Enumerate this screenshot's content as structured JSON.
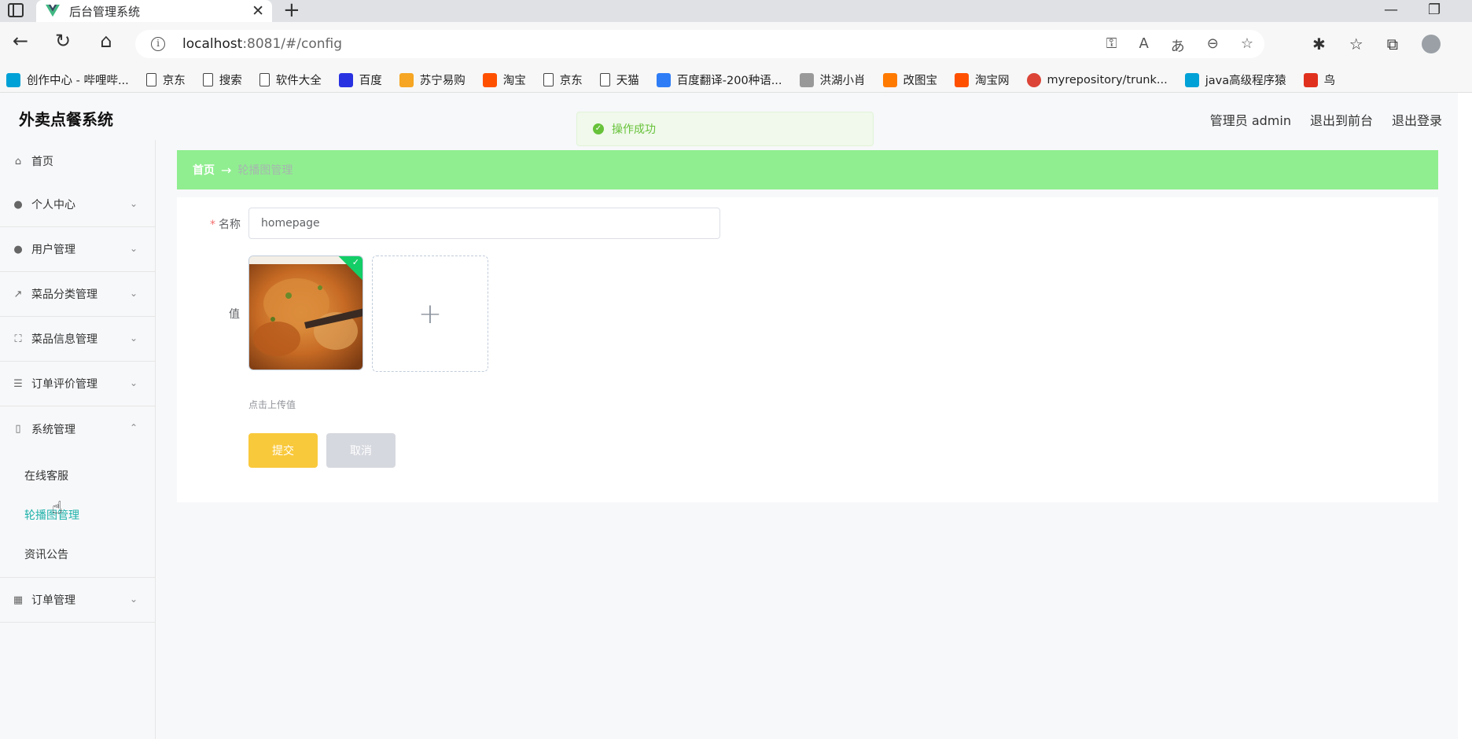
{
  "browser": {
    "tab_title": "后台管理系统",
    "tab_close": "✕",
    "new_tab": "+",
    "url_host": "localhost",
    "url_rest": ":8081/#/config",
    "bookmarks": [
      {
        "label": "创作中心 - 哔哩哔...",
        "icon": "bilibili-icon",
        "color": "#00a1d6"
      },
      {
        "label": "京东",
        "icon": "doc-icon"
      },
      {
        "label": "搜索",
        "icon": "doc-icon"
      },
      {
        "label": "软件大全",
        "icon": "doc-icon"
      },
      {
        "label": "百度",
        "icon": "baidu-paw-icon",
        "color": "#2932e1"
      },
      {
        "label": "苏宁易购",
        "icon": "suning-icon",
        "color": "#f6a623"
      },
      {
        "label": "淘宝",
        "icon": "taobao-icon",
        "color": "#ff5000"
      },
      {
        "label": "京东",
        "icon": "doc-icon"
      },
      {
        "label": "天猫",
        "icon": "doc-icon"
      },
      {
        "label": "百度翻译-200种语...",
        "icon": "translate-icon",
        "color": "#2e7df6"
      },
      {
        "label": "洪湖小肖",
        "icon": "bird-icon",
        "color": "#999999"
      },
      {
        "label": "改图宝",
        "icon": "gaitubao-icon",
        "color": "#ff7a00"
      },
      {
        "label": "淘宝网",
        "icon": "taobao-icon",
        "color": "#ff5000"
      },
      {
        "label": "myrepository/trunk...",
        "icon": "chrome-icon",
        "color": "#db4437"
      },
      {
        "label": "java高级程序猿",
        "icon": "bilibili-icon",
        "color": "#00a1d6"
      },
      {
        "label": "鸟",
        "icon": "bird-red-icon",
        "color": "#e0311e"
      }
    ]
  },
  "app": {
    "brand": "外卖点餐系统",
    "header_links": [
      "管理员 admin",
      "退出到前台",
      "退出登录"
    ],
    "toast": "操作成功",
    "sidebar": {
      "home": "首页",
      "items": [
        {
          "label": "个人中心",
          "icon": "user-icon",
          "glyph": "👤"
        },
        {
          "label": "用户管理",
          "icon": "user-icon",
          "glyph": "👤"
        },
        {
          "label": "菜品分类管理",
          "icon": "chart-icon",
          "glyph": "📈"
        },
        {
          "label": "菜品信息管理",
          "icon": "frame-icon",
          "glyph": "⛶"
        },
        {
          "label": "订单评价管理",
          "icon": "list-icon",
          "glyph": "☰"
        }
      ],
      "system": "系统管理",
      "sub_items": [
        "在线客服",
        "轮播图管理",
        "资讯公告"
      ],
      "orders": "订单管理"
    },
    "breadcrumb": {
      "home": "首页",
      "arrow": "→",
      "current": "轮播图管理"
    },
    "form": {
      "name_label": "名称",
      "name_value": "homepage",
      "value_label": "值",
      "upload_plus": "+",
      "hint": "点击上传值",
      "submit": "提交",
      "cancel": "取消"
    }
  }
}
